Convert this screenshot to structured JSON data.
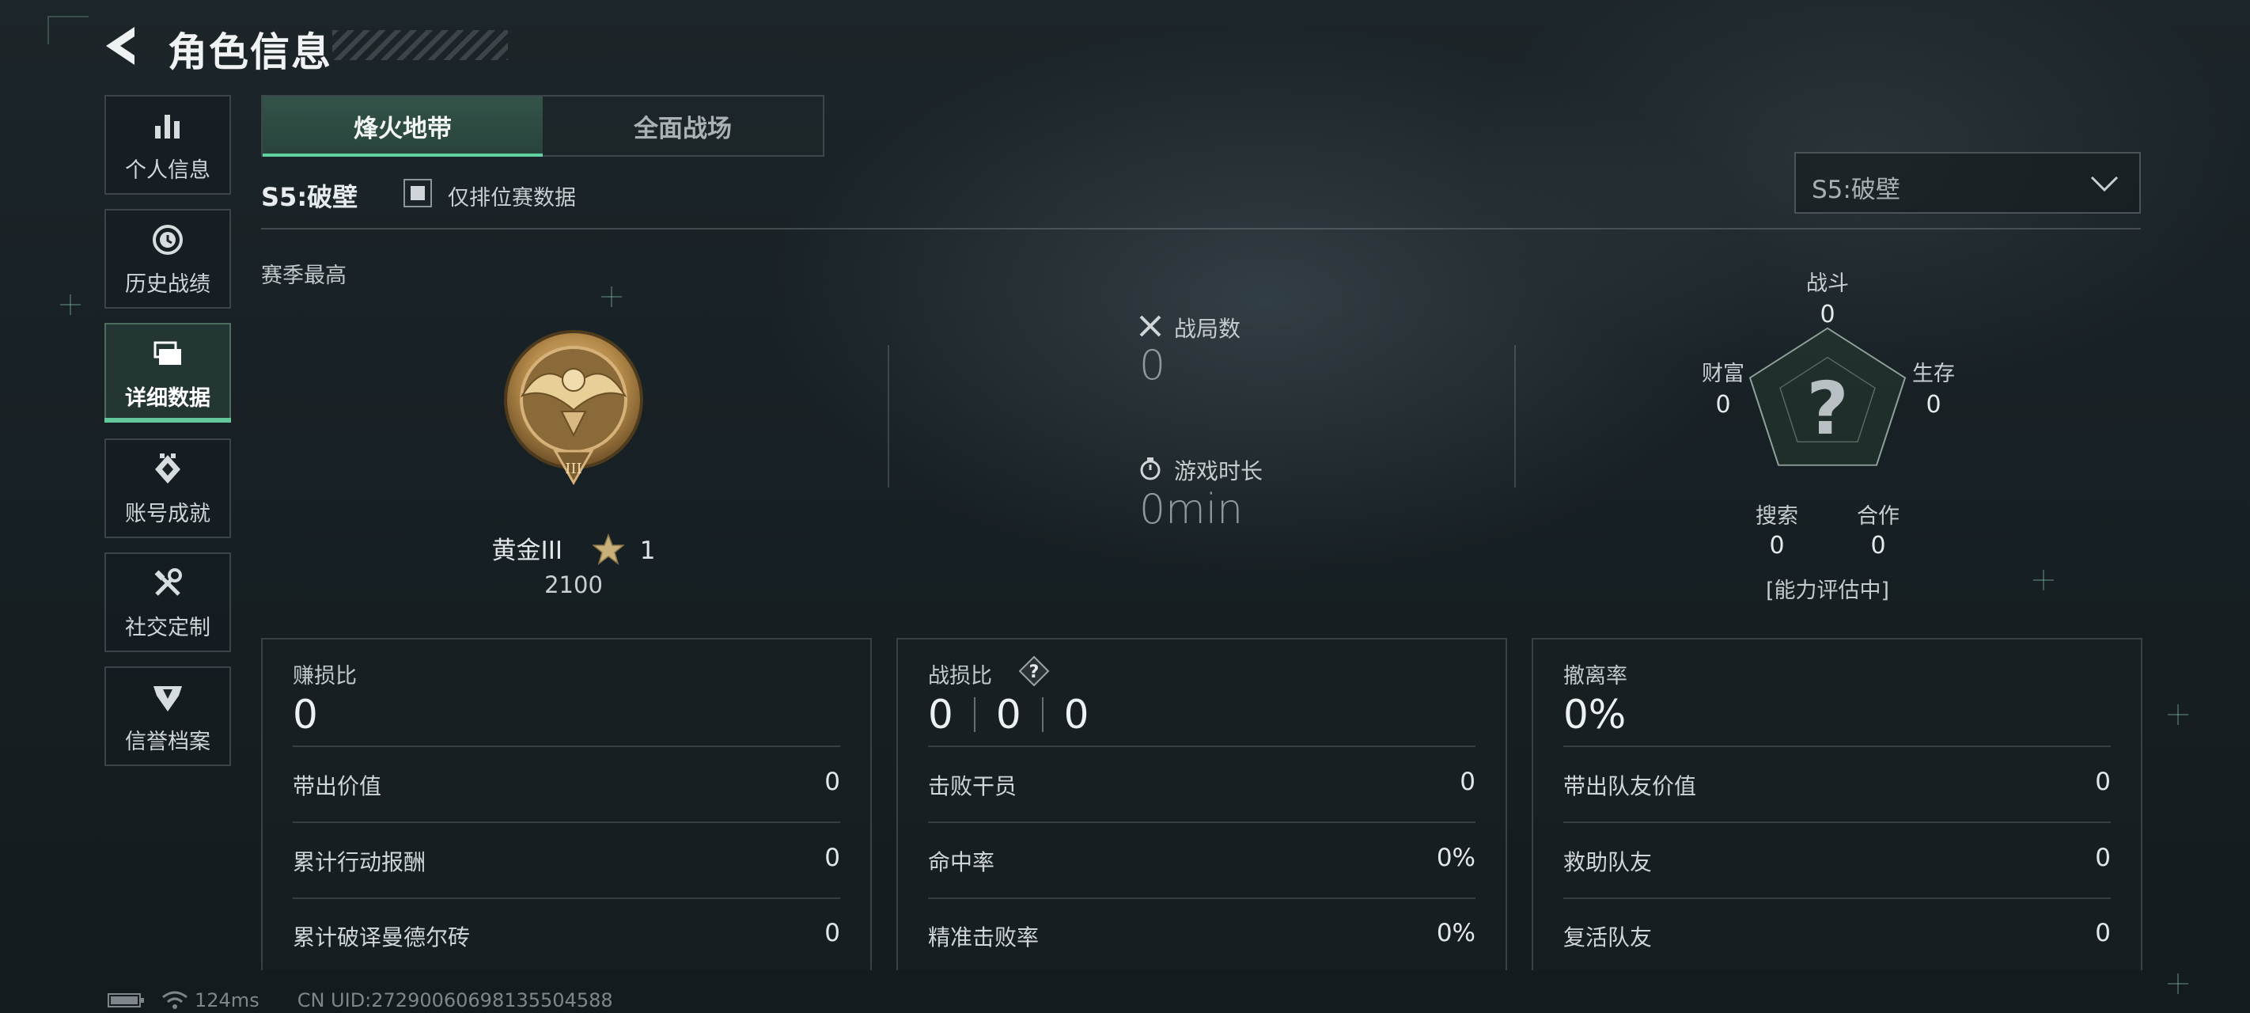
{
  "header": {
    "title": "角色信息"
  },
  "sidebar": {
    "items": [
      {
        "label": "个人信息",
        "icon": "bar-chart-icon"
      },
      {
        "label": "历史战绩",
        "icon": "history-clock-icon"
      },
      {
        "label": "详细数据",
        "icon": "folder-icon",
        "active": true
      },
      {
        "label": "账号成就",
        "icon": "achievement-icon"
      },
      {
        "label": "社交定制",
        "icon": "tools-icon"
      },
      {
        "label": "信誉档案",
        "icon": "credit-shield-icon"
      }
    ]
  },
  "tabs": [
    {
      "label": "烽火地带",
      "active": true
    },
    {
      "label": "全面战场",
      "active": false
    }
  ],
  "filter": {
    "season_label": "S5:破壁",
    "ranked_only_label": "仅排位赛数据",
    "ranked_only_checked": true,
    "season_dropdown_value": "S5:破壁"
  },
  "season_best": {
    "label": "赛季最高",
    "rank_name": "黄金III",
    "stars": "1",
    "score": "2100"
  },
  "stats": {
    "matches_label": "战局数",
    "matches_value": "0",
    "playtime_label": "游戏时长",
    "playtime_value": "0min"
  },
  "radar": {
    "combat_label": "战斗",
    "combat_value": "0",
    "survival_label": "生存",
    "survival_value": "0",
    "teamwork_label": "合作",
    "teamwork_value": "0",
    "search_label": "搜索",
    "search_value": "0",
    "wealth_label": "财富",
    "wealth_value": "0",
    "status_note": "[能力评估中]"
  },
  "cards": {
    "profit": {
      "title": "赚损比",
      "value": "0",
      "rows": [
        {
          "label": "带出价值",
          "value": "0"
        },
        {
          "label": "累计行动报酬",
          "value": "0"
        },
        {
          "label": "累计破译曼德尔砖",
          "value": "0"
        }
      ]
    },
    "kd": {
      "title": "战损比",
      "values": [
        "0",
        "0",
        "0"
      ],
      "rows": [
        {
          "label": "击败干员",
          "value": "0"
        },
        {
          "label": "命中率",
          "value": "0%"
        },
        {
          "label": "精准击败率",
          "value": "0%"
        }
      ]
    },
    "extract": {
      "title": "撤离率",
      "value": "0%",
      "rows": [
        {
          "label": "带出队友价值",
          "value": "0"
        },
        {
          "label": "救助队友",
          "value": "0"
        },
        {
          "label": "复活队友",
          "value": "0"
        }
      ]
    }
  },
  "footer": {
    "ping": "124ms",
    "uid": "CN UID:272900606981355045​88"
  },
  "colors": {
    "accent": "#5fd09f",
    "background": "#172024"
  }
}
